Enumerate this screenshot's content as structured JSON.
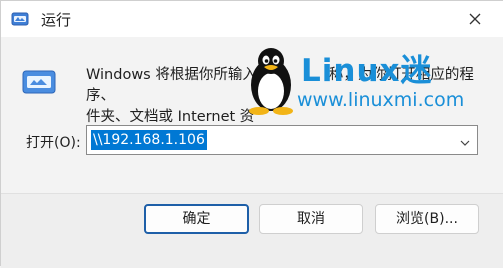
{
  "window": {
    "title": "运行"
  },
  "description": {
    "line1": "Windows 将根据你所输入",
    "line1_tail": "称，为你打开相应的程序、",
    "line2": "件夹、文档或 Internet 资"
  },
  "watermark": {
    "word": "Linux迷",
    "url": "www.linuxmi.com"
  },
  "open_field": {
    "label": "打开(O):",
    "value": "\\\\192.168.1.106"
  },
  "buttons": {
    "ok": "确定",
    "cancel": "取消",
    "browse": "浏览(B)..."
  },
  "icons": {
    "app": "run-app-icon",
    "close": "close-icon",
    "run": "run-program-icon",
    "dropdown": "chevron-down-icon",
    "mascot": "tux-penguin-icon"
  },
  "colors": {
    "accent": "#0078d4",
    "primary_border": "#1e5fa8",
    "watermark": "#1a8fd8"
  }
}
